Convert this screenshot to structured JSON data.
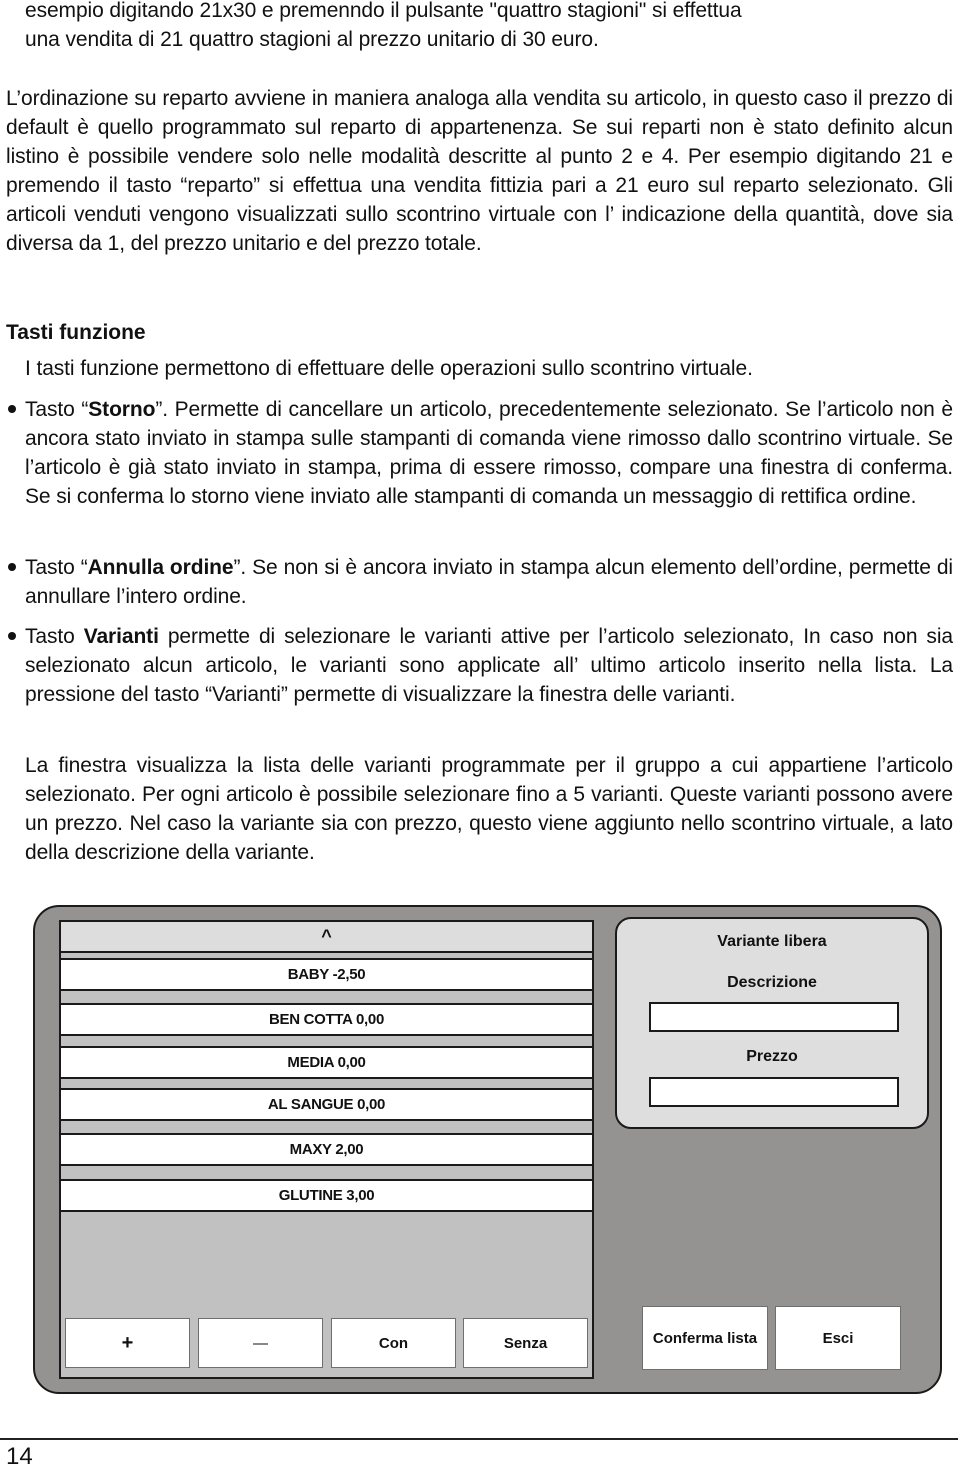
{
  "document": {
    "paragraphs": {
      "p1_line1": "esempio digitando 21x30 e premenndo il pulsante \"quattro stagioni\" si effettua",
      "p1_line2": "una vendita di 21 quattro stagioni al prezzo unitario di 30 euro.",
      "p2": "L’ordinazione su reparto avviene in maniera analoga alla vendita su articolo, in questo caso il prezzo di default è quello programmato sul reparto di appartenenza. Se sui reparti non è stato definito alcun listino è possibile vendere solo nelle modalità descritte al punto 2 e 4. Per esempio digitando 21 e premendo il tasto “reparto” si effettua una vendita fittizia pari a 21 euro sul reparto selezionato. Gli articoli venduti vengono visualizzati sullo scontrino virtuale con l’ indicazione della quantità, dove sia diversa da 1, del prezzo unitario e del prezzo totale."
    },
    "section_heading": "Tasti funzione",
    "section_intro": "I tasti funzione permettono di effettuare delle operazioni sullo scontrino virtuale.",
    "bullets": [
      {
        "prefix": "Tasto “",
        "bold": "Storno",
        "suffix": "”. Permette di cancellare un articolo, precedentemente selezionato. Se l’articolo non è ancora stato inviato in stampa sulle stampanti di comanda viene rimosso dallo scontrino virtuale. Se l’articolo è già stato inviato in stampa, prima di essere rimosso, compare una finestra di conferma. Se si conferma lo storno viene inviato alle stampanti di comanda un messaggio di rettifica ordine."
      },
      {
        "prefix": "Tasto “",
        "bold": "Annulla ordine",
        "suffix": "”. Se non si è ancora inviato in stampa alcun elemento dell’ordine, permette di annullare l’intero ordine."
      },
      {
        "prefix": "Tasto ",
        "bold": "Varianti",
        "suffix": " permette di selezionare le varianti attive per l’articolo selezionato, In caso non sia selezionato alcun articolo, le varianti sono applicate all’ ultimo articolo inserito nella lista. La pressione del tasto “Varianti” permette di visualizzare la finestra delle varianti."
      }
    ],
    "closing_paragraph": "La finestra visualizza la lista delle varianti programmate per il gruppo a cui appartiene l’articolo selezionato. Per ogni articolo è possibile selezionare fino a 5 varianti. Queste varianti possono avere un prezzo. Nel caso la variante sia con prezzo, questo viene aggiunto nello scontrino virtuale, a lato della descrizione della variante.",
    "page_number": "14"
  },
  "variants_window": {
    "scroll_up_label": "^",
    "variants": [
      {
        "label": "BABY -2,50"
      },
      {
        "label": "BEN COTTA 0,00"
      },
      {
        "label": "MEDIA 0,00"
      },
      {
        "label": "AL SANGUE 0,00"
      },
      {
        "label": "MAXY 2,00"
      },
      {
        "label": "GLUTINE 3,00"
      }
    ],
    "list_buttons": {
      "plus": "+",
      "minus": "—",
      "with": "Con",
      "without": "Senza"
    },
    "free_variant": {
      "title": "Variante libera",
      "description_label": "Descrizione",
      "description_value": "",
      "price_label": "Prezzo",
      "price_value": ""
    },
    "actions": {
      "confirm": "Conferma lista",
      "exit": "Esci"
    },
    "colors": {
      "frame": "#949392",
      "list_bg": "#c1c1c1",
      "panel_bg": "#dedede",
      "item_bg": "#ffffff"
    }
  }
}
